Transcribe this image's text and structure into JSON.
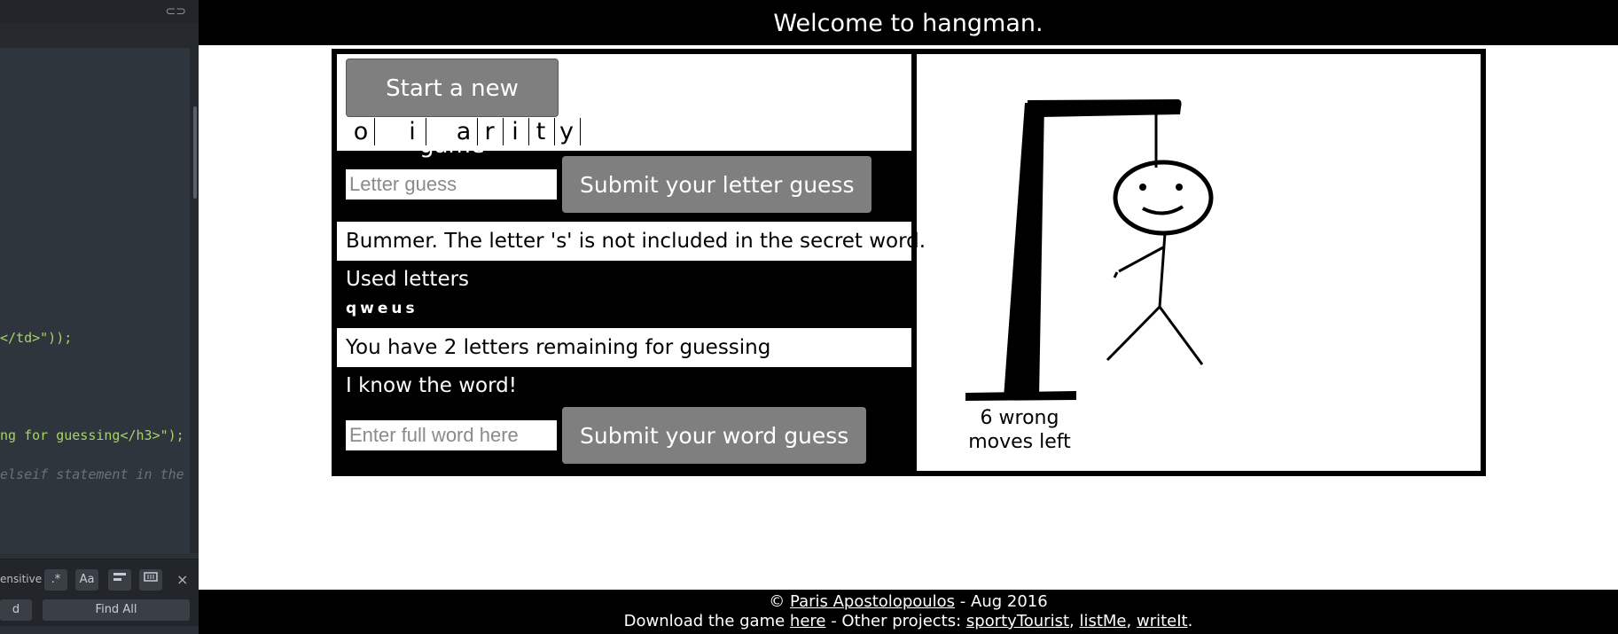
{
  "editor": {
    "code_lines": [
      {
        "pre": "</td>\"));",
        "kind": "string"
      },
      {
        "pre": "ng for guessing</h3>\");",
        "kind": "string"
      },
      {
        "pre": "elseif statement in the",
        "kind": "comment"
      }
    ],
    "find": {
      "case_label": "ensitive",
      "opt_regex": ".*",
      "opt_case": "Aa",
      "find_left_label": "d",
      "find_all_label": "Find All",
      "close": "×"
    }
  },
  "header": {
    "title": "Welcome to hangman."
  },
  "game": {
    "new_game_label": "Start a new game",
    "word_slots": [
      "o",
      "",
      "i",
      "",
      "a",
      "r",
      "i",
      "t",
      "y"
    ],
    "letter_placeholder": "Letter guess",
    "submit_letter_label": "Submit your letter guess",
    "result_message": "Bummer. The letter 's' is not included in the secret word.",
    "used_title": "Used letters",
    "used_letters": "qweus",
    "remaining_message": "You have 2 letters remaining for guessing",
    "know_title": "I know the word!",
    "word_placeholder": "Enter full word here",
    "submit_word_label": "Submit your word guess",
    "moves_left_line1": "6 wrong",
    "moves_left_line2": "moves left"
  },
  "footer": {
    "copyright": "©",
    "author": "Paris Apostolopoulos",
    "date": " - Aug 2016",
    "download_prefix": "Download the game ",
    "download_link": "here",
    "other_prefix": " - Other projects: ",
    "project1": "sportyTourist",
    "project2": "listMe",
    "project3": "writeIt",
    "sep": ", ",
    "end": "."
  }
}
